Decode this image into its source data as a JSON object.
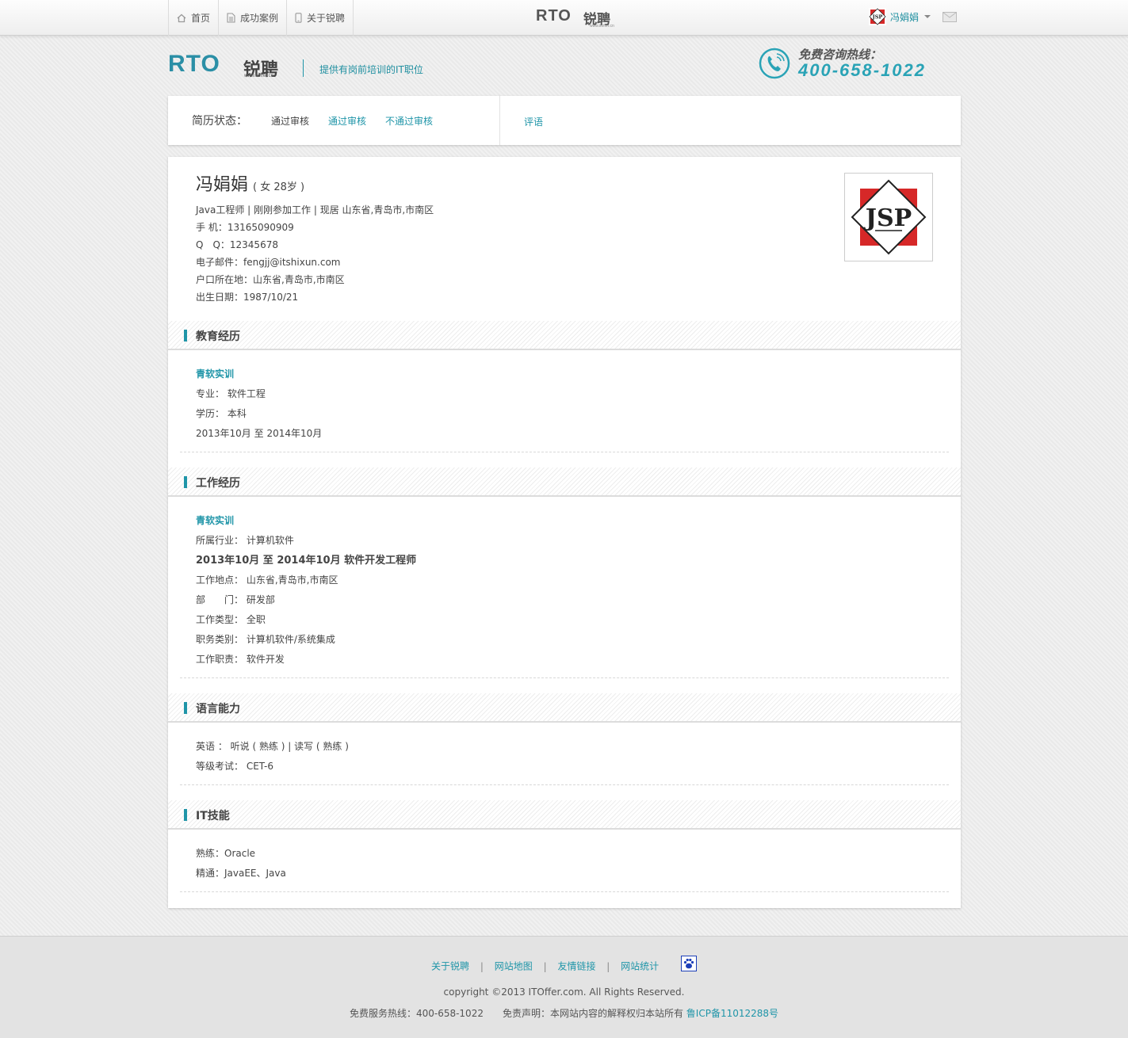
{
  "nav": {
    "items": [
      {
        "label": "首页",
        "icon": "home-icon"
      },
      {
        "label": "成功案例",
        "icon": "document-icon"
      },
      {
        "label": "关于锐聘",
        "icon": "phone-icon"
      }
    ],
    "logo_text": "RTO",
    "logo_cn": "锐聘",
    "logo_url": "www.itoffer.cn",
    "user_name": "冯娟娟"
  },
  "header": {
    "logo_text": "RTO",
    "logo_cn": "锐聘",
    "logo_url": "www.itoffer.cn",
    "slogan": "提供有岗前培训的IT职位",
    "hotline_label": "免费咨询热线：",
    "hotline_number": "400-658-1022"
  },
  "status": {
    "label": "简历状态：",
    "current": "通过审核",
    "option_pass": "通过审核",
    "option_fail": "不通过审核",
    "comment": "评语"
  },
  "profile": {
    "name": "冯娟娟",
    "meta": "( 女 28岁 )",
    "lines": [
      "Java工程师 | 刚刚参加工作 | 现居 山东省,青岛市,市南区",
      "手 机：13165090909",
      "Q　Q：12345678",
      "电子邮件：fengjj@itshixun.com",
      "户口所在地：山东省,青岛市,市南区",
      "出生日期：1987/10/21"
    ],
    "photo_text": "JSP"
  },
  "education": {
    "title": "教育经历",
    "org": "青软实训",
    "major": "专业： 软件工程",
    "degree": "学历： 本科",
    "period": "2013年10月 至 2014年10月"
  },
  "work": {
    "title": "工作经历",
    "org": "青软实训",
    "industry": "所属行业： 计算机软件",
    "period_title": "2013年10月 至 2014年10月 软件开发工程师",
    "location": "工作地点： 山东省,青岛市,市南区",
    "department": "部　　门： 研发部",
    "type": "工作类型： 全职",
    "category": "职务类别： 计算机软件/系统集成",
    "duty": "工作职责： 软件开发"
  },
  "language": {
    "title": "语言能力",
    "english": "英语 ： 听说 ( 熟练 ) | 读写 ( 熟练 )",
    "exam": "等级考试： CET-6"
  },
  "skills": {
    "title": "IT技能",
    "proficient": "熟练：Oracle",
    "expert": "精通：JavaEE、Java"
  },
  "footer": {
    "links": [
      "关于锐聘",
      "网站地图",
      "友情链接",
      "网站统计"
    ],
    "copyright": "copyright ©2013 ITOffer.com. All Rights Reserved.",
    "legal": "免费服务热线：400-658-1022　　免责声明：本网站内容的解释权归本站所有",
    "icp": "鲁ICP备11012288号"
  },
  "colors": {
    "accent": "#1f95a8",
    "text": "#444444",
    "background": "#ececec",
    "photo_red": "#d62828"
  }
}
